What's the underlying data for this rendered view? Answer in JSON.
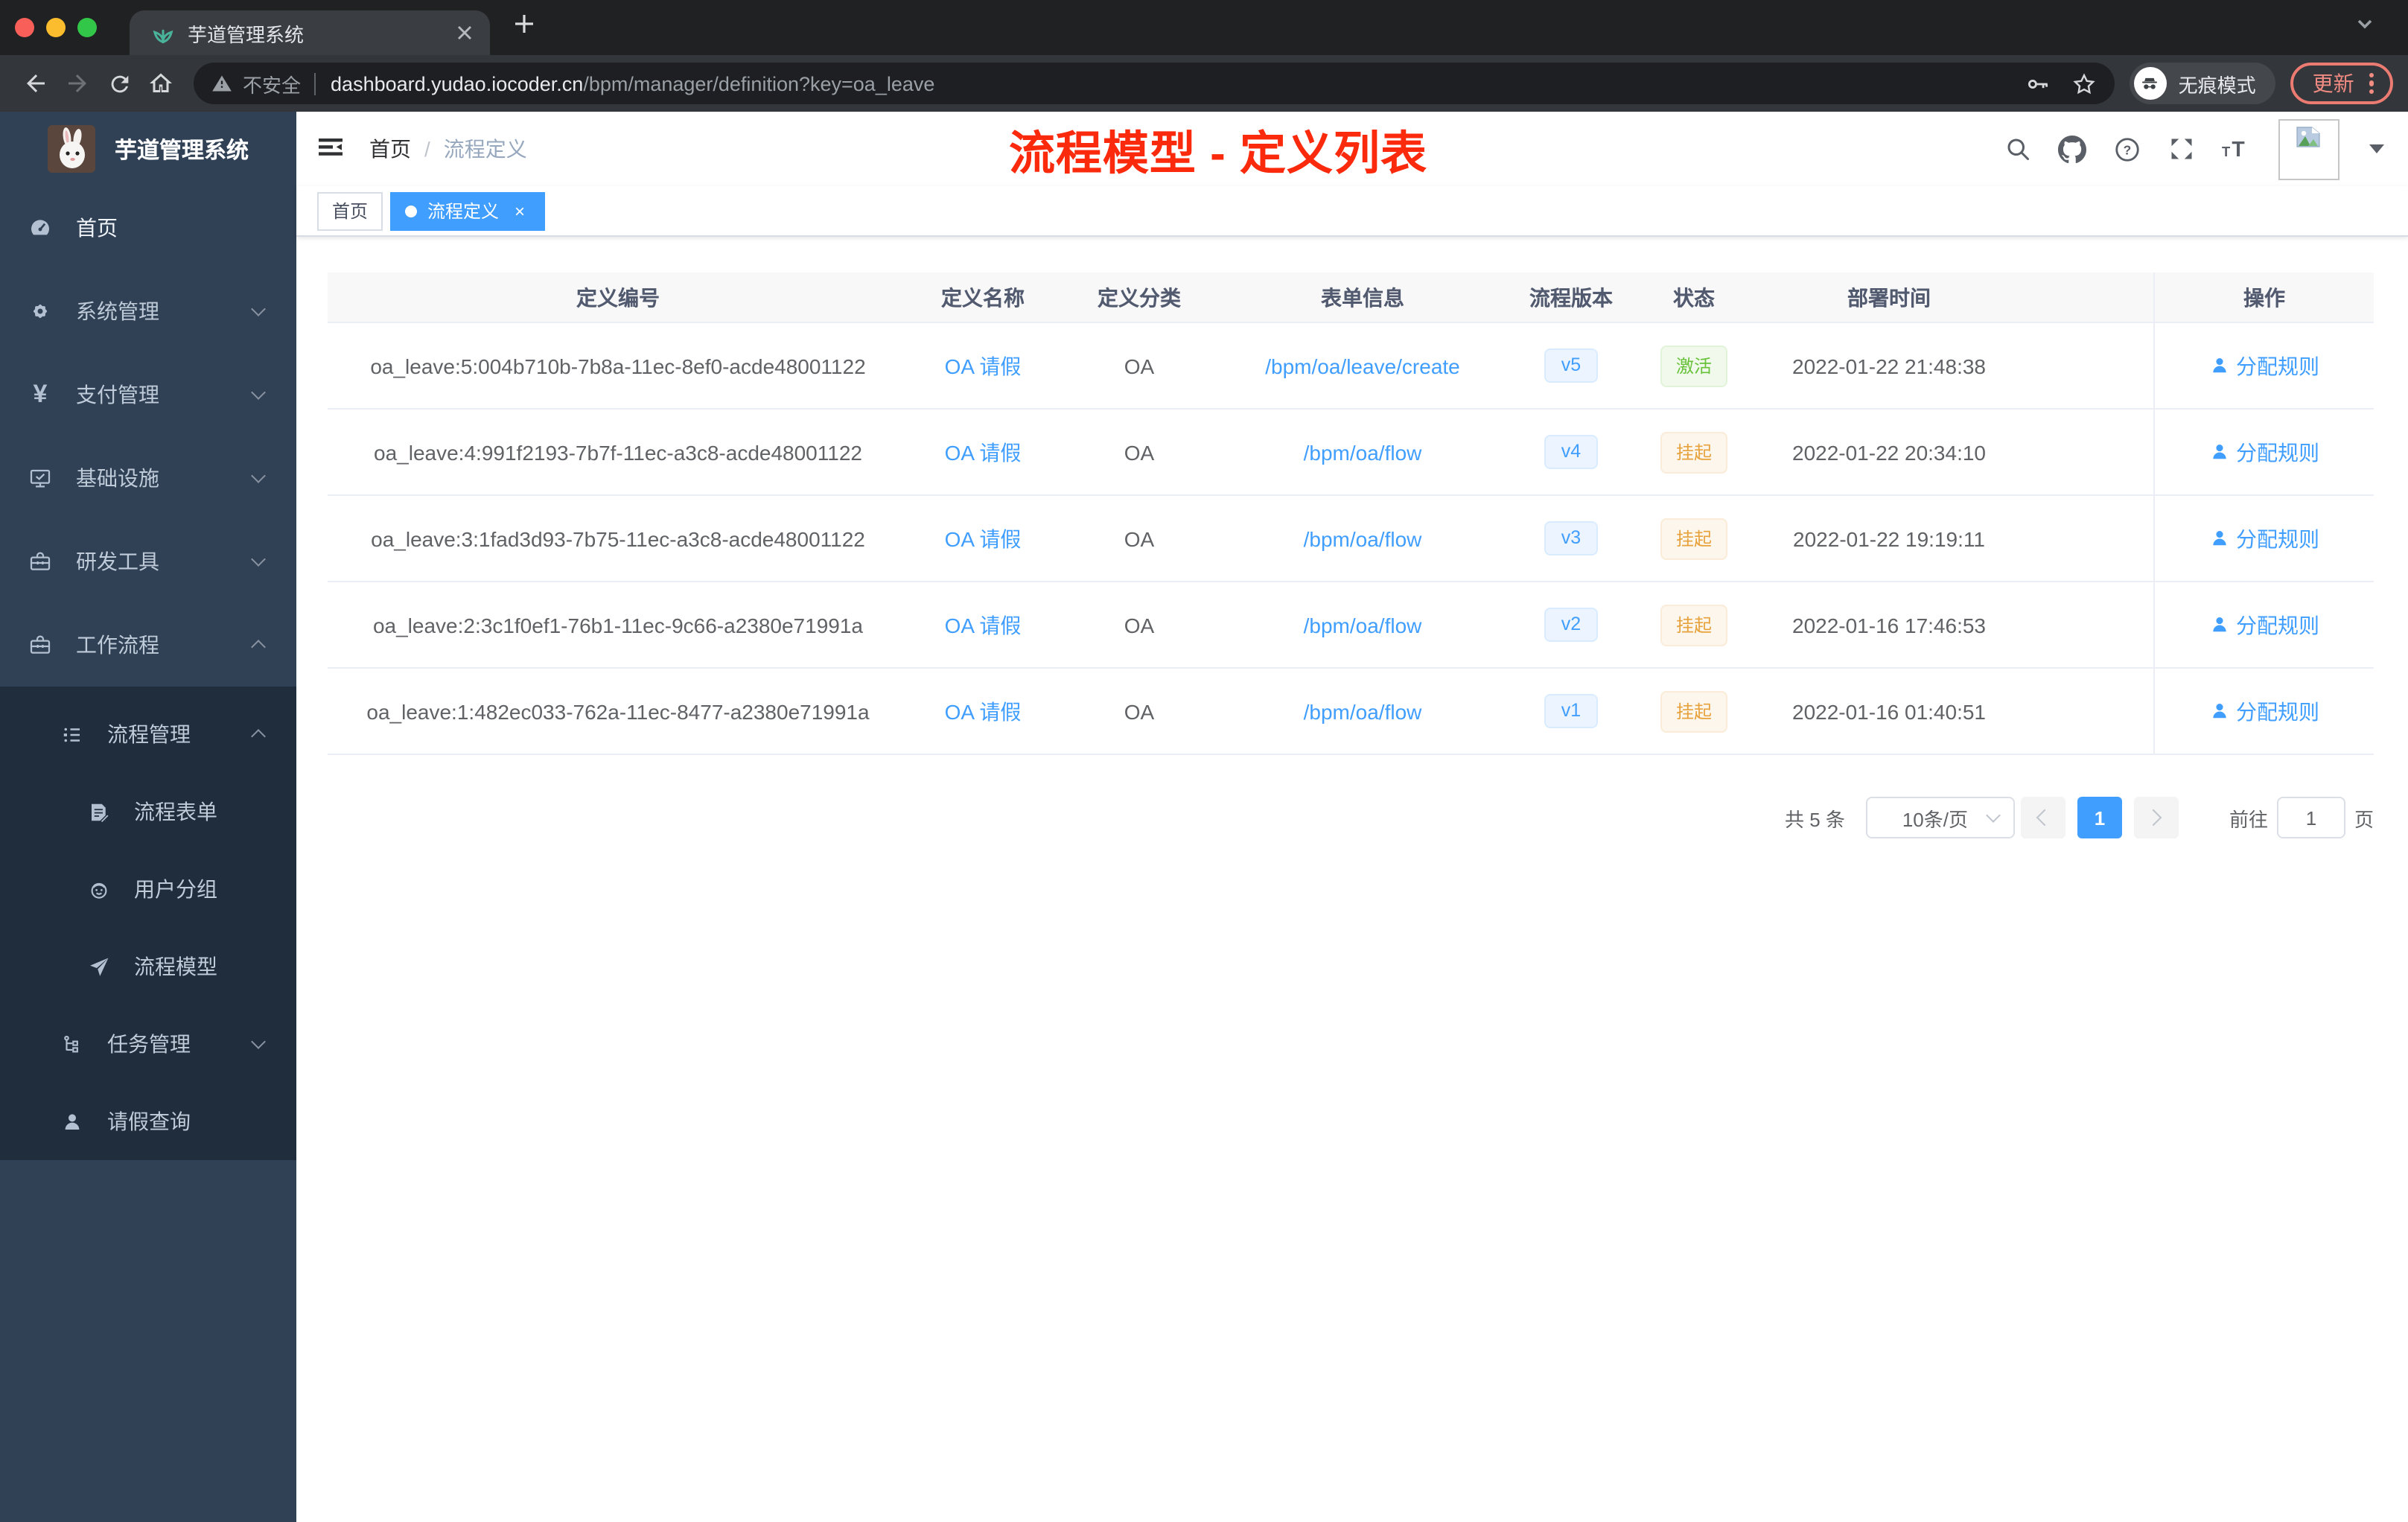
{
  "browser": {
    "tab_title": "芋道管理系统",
    "url_security": "不安全",
    "url_host": "dashboard.yudao.iocoder.cn",
    "url_path": "/bpm/manager/definition?key=oa_leave",
    "incognito_label": "无痕模式",
    "update_label": "更新"
  },
  "sidebar": {
    "logo_title": "芋道管理系统",
    "items": [
      {
        "label": "首页"
      },
      {
        "label": "系统管理"
      },
      {
        "label": "支付管理"
      },
      {
        "label": "基础设施"
      },
      {
        "label": "研发工具"
      },
      {
        "label": "工作流程"
      },
      {
        "label": "流程管理"
      },
      {
        "label": "流程表单"
      },
      {
        "label": "用户分组"
      },
      {
        "label": "流程模型"
      },
      {
        "label": "任务管理"
      },
      {
        "label": "请假查询"
      }
    ]
  },
  "header": {
    "breadcrumb_home": "首页",
    "breadcrumb_sep": "/",
    "breadcrumb_current": "流程定义",
    "annotation": "流程模型 - 定义列表"
  },
  "tags": {
    "home": "首页",
    "current": "流程定义"
  },
  "table": {
    "columns": [
      "定义编号",
      "定义名称",
      "定义分类",
      "表单信息",
      "流程版本",
      "状态",
      "部署时间",
      "操作"
    ],
    "rows": [
      {
        "id": "oa_leave:5:004b710b-7b8a-11ec-8ef0-acde48001122",
        "name": "OA 请假",
        "category": "OA",
        "form": "/bpm/oa/leave/create",
        "version": "v5",
        "status": "激活",
        "status_type": "success",
        "time": "2022-01-22 21:48:38",
        "action": "分配规则"
      },
      {
        "id": "oa_leave:4:991f2193-7b7f-11ec-a3c8-acde48001122",
        "name": "OA 请假",
        "category": "OA",
        "form": "/bpm/oa/flow",
        "version": "v4",
        "status": "挂起",
        "status_type": "warning",
        "time": "2022-01-22 20:34:10",
        "action": "分配规则"
      },
      {
        "id": "oa_leave:3:1fad3d93-7b75-11ec-a3c8-acde48001122",
        "name": "OA 请假",
        "category": "OA",
        "form": "/bpm/oa/flow",
        "version": "v3",
        "status": "挂起",
        "status_type": "warning",
        "time": "2022-01-22 19:19:11",
        "action": "分配规则"
      },
      {
        "id": "oa_leave:2:3c1f0ef1-76b1-11ec-9c66-a2380e71991a",
        "name": "OA 请假",
        "category": "OA",
        "form": "/bpm/oa/flow",
        "version": "v2",
        "status": "挂起",
        "status_type": "warning",
        "time": "2022-01-16 17:46:53",
        "action": "分配规则"
      },
      {
        "id": "oa_leave:1:482ec033-762a-11ec-8477-a2380e71991a",
        "name": "OA 请假",
        "category": "OA",
        "form": "/bpm/oa/flow",
        "version": "v1",
        "status": "挂起",
        "status_type": "warning",
        "time": "2022-01-16 01:40:51",
        "action": "分配规则"
      }
    ]
  },
  "pagination": {
    "total": "共 5 条",
    "page_size": "10条/页",
    "page": "1",
    "goto_label": "前往",
    "goto_value": "1",
    "unit_label": "页"
  },
  "colors": {
    "accent": "#409eff",
    "annotation_red": "#fb2a0d",
    "success_text": "#67c23a",
    "warning_text": "#e6a23c",
    "sidebar_bg": "#304156",
    "submenu_bg": "#1f2d3d",
    "table_header_bg": "#f8f8f9"
  }
}
